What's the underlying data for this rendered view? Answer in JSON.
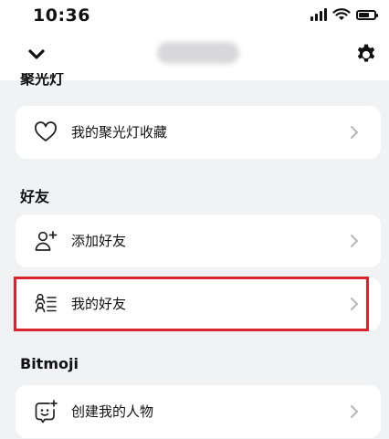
{
  "status_bar": {
    "time": "10:36"
  },
  "sections": {
    "spotlight": {
      "header": "聚光灯",
      "items": [
        {
          "label": "我的聚光灯收藏",
          "icon": "heart-icon"
        }
      ]
    },
    "friends": {
      "header": "好友",
      "items": [
        {
          "label": "添加好友",
          "icon": "add-friend-icon"
        },
        {
          "label": "我的好友",
          "icon": "friends-list-icon"
        }
      ]
    },
    "bitmoji": {
      "header": "Bitmoji",
      "items": [
        {
          "label": "创建我的人物",
          "icon": "bitmoji-face-icon"
        }
      ]
    }
  },
  "colors": {
    "background": "#f1f2f4",
    "card": "#ffffff",
    "highlight": "#d9232d"
  }
}
